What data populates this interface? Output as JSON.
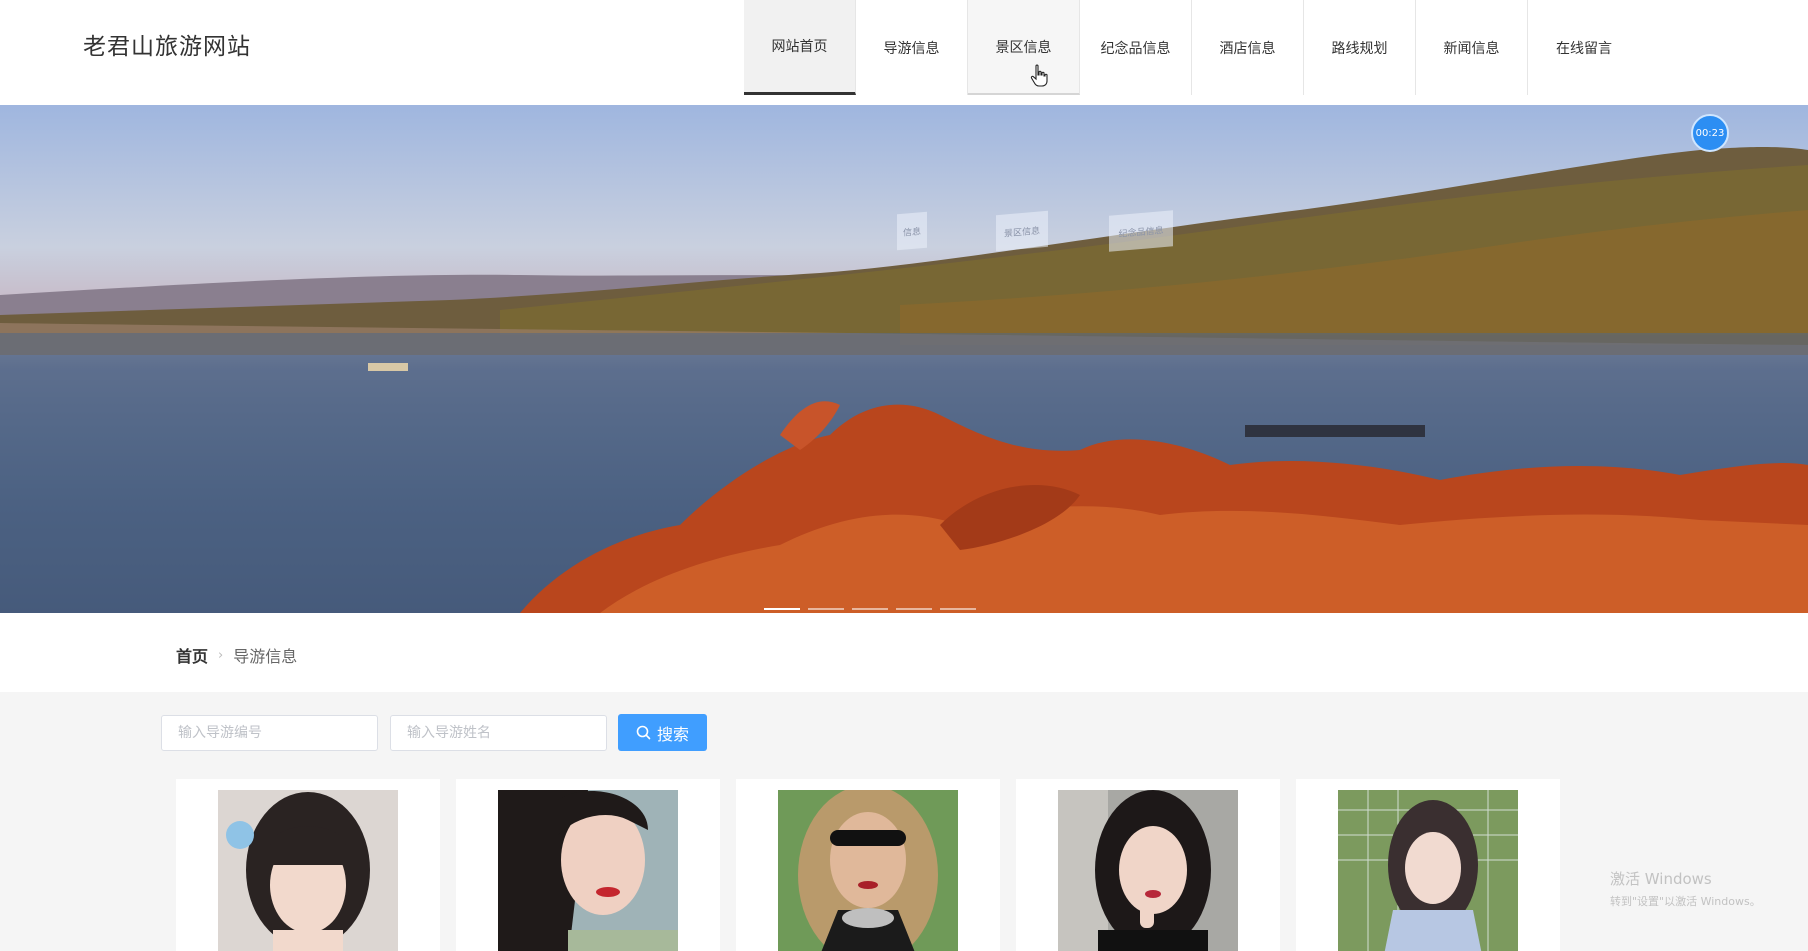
{
  "header": {
    "site_title": "老君山旅游网站",
    "nav": [
      {
        "label": "网站首页"
      },
      {
        "label": "导游信息"
      },
      {
        "label": "景区信息"
      },
      {
        "label": "纪念品信息"
      },
      {
        "label": "酒店信息"
      },
      {
        "label": "路线规划"
      },
      {
        "label": "新闻信息"
      },
      {
        "label": "在线留言"
      }
    ]
  },
  "banner": {
    "timer": "00:23",
    "ghost_tabs": [
      "信息",
      "景区信息",
      "纪念品信息"
    ]
  },
  "breadcrumb": {
    "home": "首页",
    "current": "导游信息"
  },
  "search": {
    "guide_id_placeholder": "输入导游编号",
    "guide_name_placeholder": "输入导游姓名",
    "button_label": "搜索"
  },
  "watermark": {
    "line1": "激活 Windows",
    "line2": "转到\"设置\"以激活 Windows。"
  },
  "colors": {
    "accent": "#409eff",
    "active_nav_underline": "#333333"
  }
}
